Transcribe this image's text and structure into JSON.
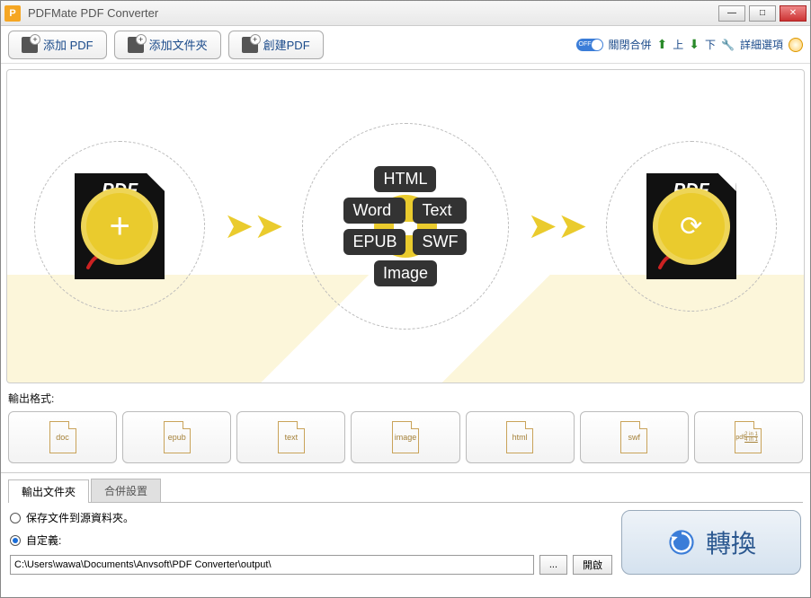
{
  "window": {
    "title": "PDFMate PDF Converter"
  },
  "toolbar": {
    "add_pdf": "添加 PDF",
    "add_folder": "添加文件夾",
    "create_pdf": "創建PDF",
    "merge_toggle_state": "OFF",
    "merge_label": "關閉合併",
    "up": "上",
    "down": "下",
    "advanced": "詳細選項"
  },
  "stage": {
    "source_label": "PDF",
    "target_label": "PDF",
    "formats": [
      "HTML",
      "Word",
      "Text",
      "EPUB",
      "SWF",
      "Image"
    ]
  },
  "output_formats_label": "輸出格式:",
  "output_formats": [
    {
      "key": "doc",
      "label": "doc"
    },
    {
      "key": "epub",
      "label": "epub"
    },
    {
      "key": "text",
      "label": "text"
    },
    {
      "key": "image",
      "label": "image"
    },
    {
      "key": "html",
      "label": "html"
    },
    {
      "key": "swf",
      "label": "swf"
    },
    {
      "key": "pdf",
      "label": "pdf",
      "sub": "2 in 1\n4 in 1"
    }
  ],
  "tabs": {
    "output_folder": "輸出文件夾",
    "merge_settings": "合併設置"
  },
  "output": {
    "save_to_source": "保存文件到源資料夾。",
    "custom_label": "自定義:",
    "path": "C:\\Users\\wawa\\Documents\\Anvsoft\\PDF Converter\\output\\",
    "browse": "...",
    "open": "開啟"
  },
  "convert_label": "轉換"
}
